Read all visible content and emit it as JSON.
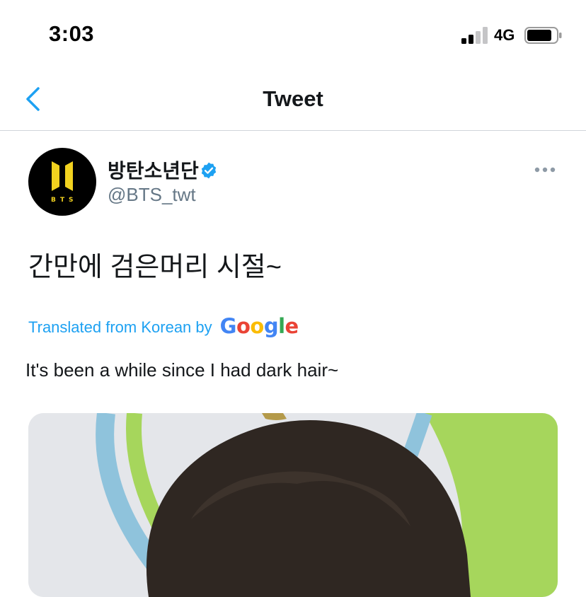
{
  "status_bar": {
    "time": "3:03",
    "network": "4G",
    "signal_bars": 2,
    "signal_bars_total": 4
  },
  "nav": {
    "title": "Tweet",
    "back_icon": "chevron-left-icon"
  },
  "tweet": {
    "display_name": "방탄소년단",
    "verified": true,
    "handle": "@BTS_twt",
    "text": "간만에 검은머리 시절~",
    "translated_label": "Translated from Korean by",
    "translation": "It's been a while since I had dark hair~"
  },
  "colors": {
    "accent": "#1da1f2",
    "text_primary": "#14171a",
    "text_secondary": "#657786",
    "divider": "#d0d5da",
    "avatar_bg": "#000000",
    "logo_yellow": "#f2d21f",
    "google_blue": "#4285f4",
    "google_red": "#ea4335",
    "google_yellow": "#fbbc05",
    "google_green": "#34a853"
  }
}
